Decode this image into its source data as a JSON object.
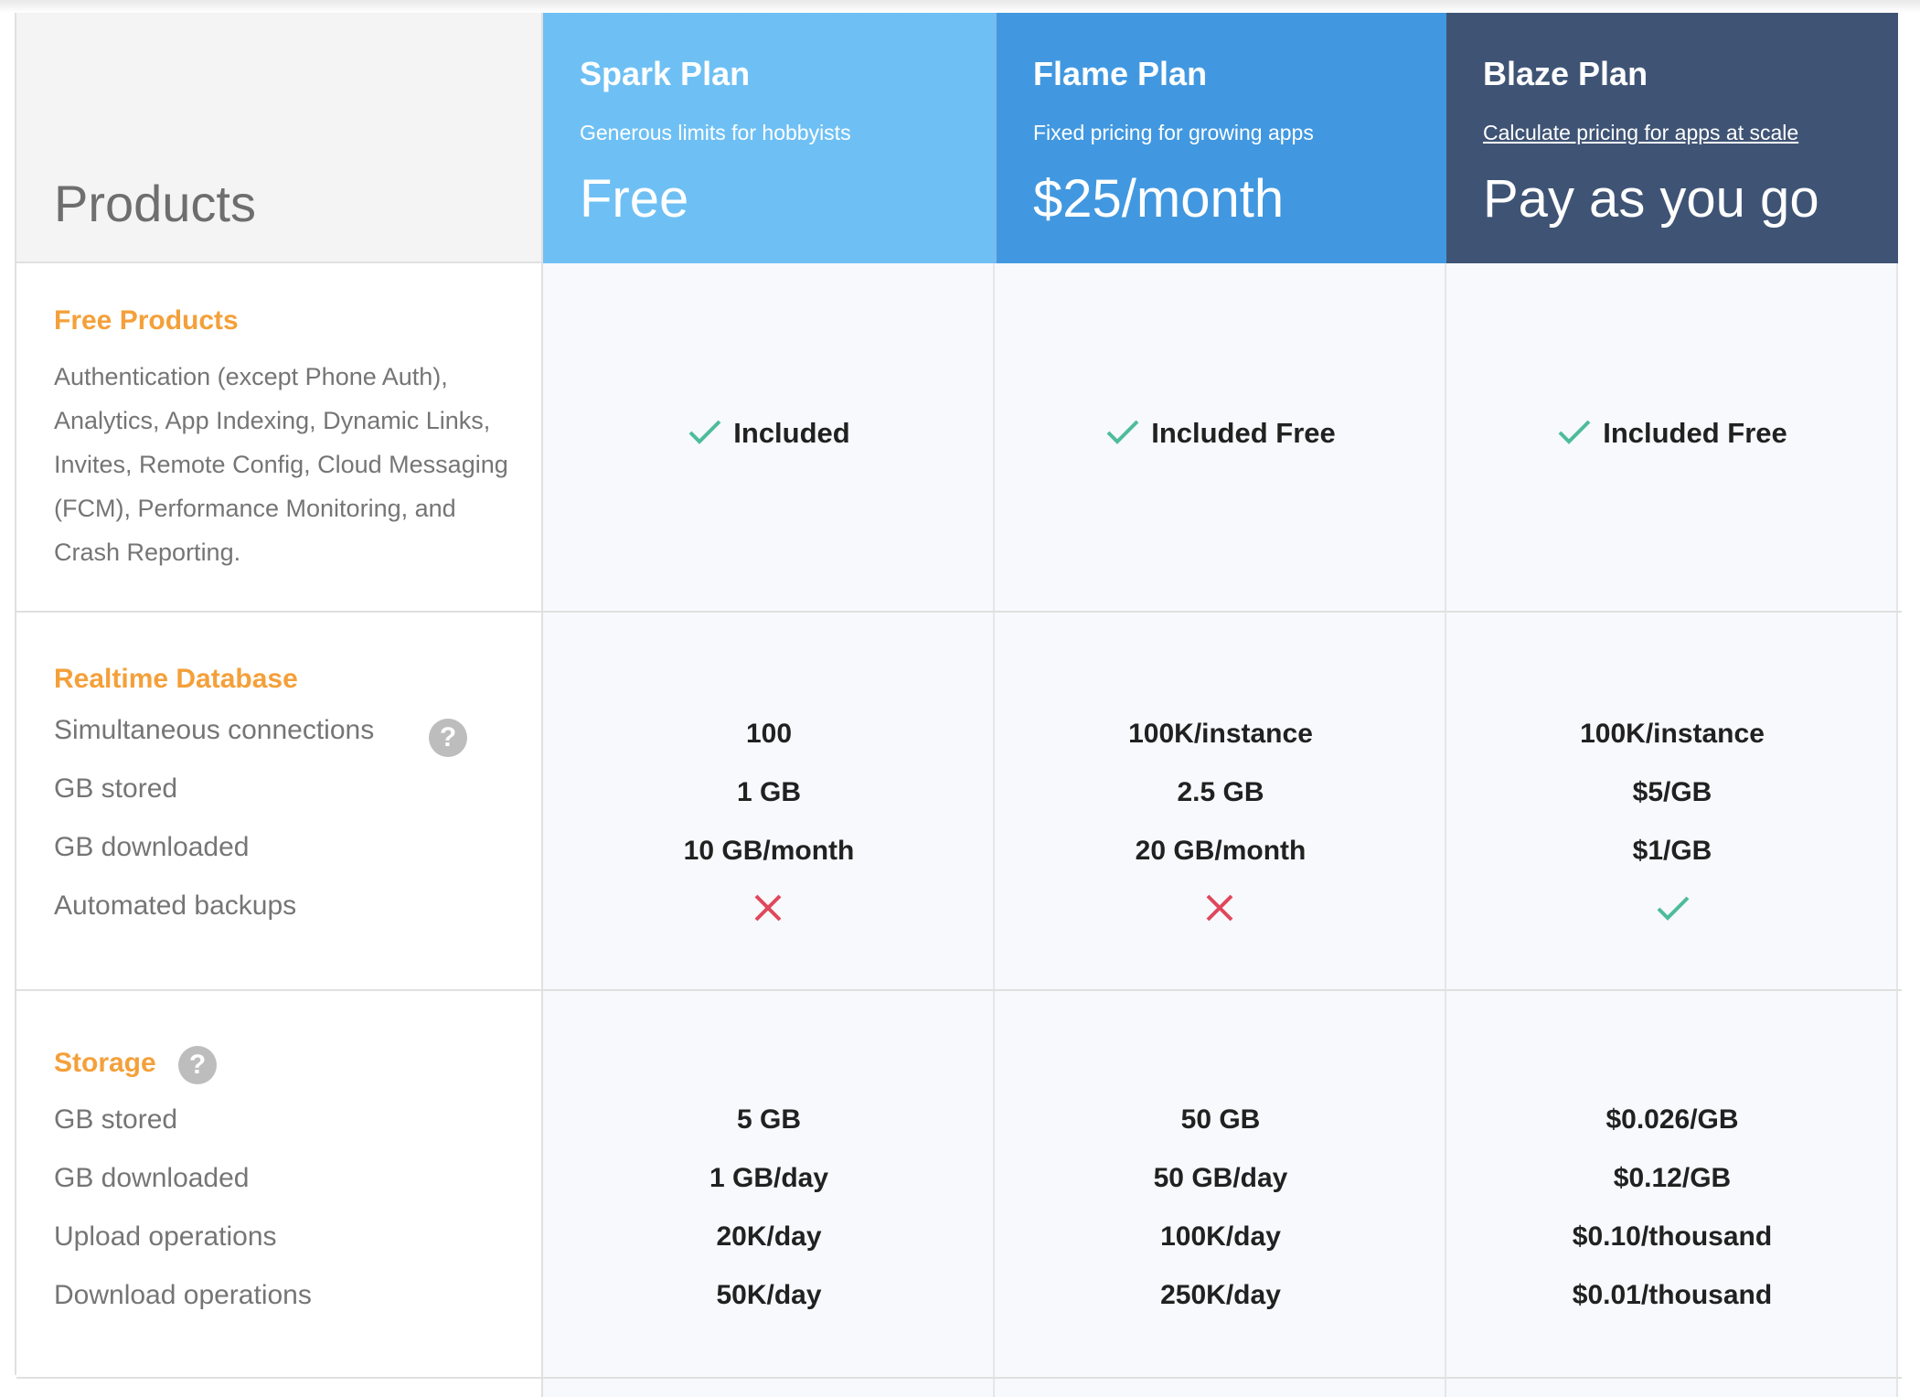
{
  "header": {
    "products_title": "Products",
    "plans": [
      {
        "name": "Spark Plan",
        "subtitle": "Generous limits for hobbyists",
        "price": "Free",
        "color": "#6ec0f4"
      },
      {
        "name": "Flame Plan",
        "subtitle": "Fixed pricing for growing apps",
        "price": "$25/month",
        "color": "#4198e0"
      },
      {
        "name": "Blaze Plan",
        "subtitle": "Calculate pricing for apps at scale",
        "price": "Pay as you go",
        "color": "#3f5475"
      }
    ]
  },
  "free_products": {
    "title": "Free Products",
    "description": "Authentication (except Phone Auth), Analytics, App Indexing, Dynamic Links, Invites, Remote Config, Cloud Messaging (FCM), Performance Monitoring, and Crash Reporting.",
    "values": [
      "Included",
      "Included Free",
      "Included Free"
    ]
  },
  "realtime_database": {
    "title": "Realtime Database",
    "items": [
      "Simultaneous connections",
      "GB stored",
      "GB downloaded",
      "Automated backups"
    ],
    "help_icon": "?",
    "spark": [
      "100",
      "1 GB",
      "10 GB/month"
    ],
    "flame": [
      "100K/instance",
      "2.5 GB",
      "20 GB/month"
    ],
    "blaze": [
      "100K/instance",
      "$5/GB",
      "$1/GB"
    ],
    "backups": [
      "cross-icon",
      "cross-icon",
      "check-icon"
    ]
  },
  "storage": {
    "title": "Storage",
    "help_icon": "?",
    "items": [
      "GB stored",
      "GB downloaded",
      "Upload operations",
      "Download operations"
    ],
    "spark": [
      "5 GB",
      "1 GB/day",
      "20K/day",
      "50K/day"
    ],
    "flame": [
      "50 GB",
      "50 GB/day",
      "100K/day",
      "250K/day"
    ],
    "blaze": [
      "$0.026/GB",
      "$0.12/GB",
      "$0.10/thousand",
      "$0.01/thousand"
    ]
  },
  "colors": {
    "accent_orange": "#f4a03a",
    "check_green": "#4ebc9c",
    "cross_red": "#e0475b"
  }
}
